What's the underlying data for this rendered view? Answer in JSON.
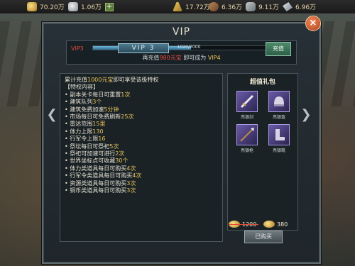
{
  "topbar": {
    "gold": "70.20万",
    "silver": "1.06万",
    "food": "17.72万",
    "wood": "6.36万",
    "stone": "9.11万",
    "iron": "6.96万",
    "plus_label": "+"
  },
  "dialog": {
    "title": "VIP",
    "close_label": "×"
  },
  "vip_progress": {
    "level_label": "VIP3",
    "progress_text": "1020/2000",
    "progress_fraction": 0.51,
    "hint_prefix": "再充值",
    "hint_amount": "980元宝",
    "hint_suffix": "即可成为",
    "hint_target": "VIP4",
    "recharge_label": "充值"
  },
  "banner": {
    "label": "VIP 3"
  },
  "privileges": {
    "intro_prefix": "累计充值",
    "intro_amount": "1000元宝",
    "intro_suffix": "即可享受该级特权",
    "section_header": "【特权内容】",
    "items": [
      {
        "text": "• 副本关卡每日可重置",
        "num": "1次"
      },
      {
        "text": "• 建筑队列",
        "num": "3个"
      },
      {
        "text": "• 建筑免费加速",
        "num": "5分钟"
      },
      {
        "text": "• 市场每日可免费刷新",
        "num": "25次"
      },
      {
        "text": "• 雷达范围",
        "num": "15里"
      },
      {
        "text": "• 体力上限",
        "num": "130"
      },
      {
        "text": "• 行军令上限",
        "num": "16"
      },
      {
        "text": "• 祭坛每日可祭祀",
        "num": "5次"
      },
      {
        "text": "• 祭祀可加速可进行",
        "num": "2次"
      },
      {
        "text": "• 世界坐标点可收藏",
        "num": "30个"
      },
      {
        "text": "• 体力类道具每日可购买",
        "num": "4次"
      },
      {
        "text": "• 行军令类道具每日可购买",
        "num": "4次"
      },
      {
        "text": "• 资源类道具每日可购买",
        "num": "3次"
      },
      {
        "text": "• 铜币类道具每日可购买",
        "num": "3次"
      }
    ]
  },
  "gift": {
    "title": "超值礼包",
    "items": [
      {
        "name": "亮银剑",
        "icon": "sword-icon"
      },
      {
        "name": "亮银盔",
        "icon": "helmet-icon"
      },
      {
        "name": "亮银枪",
        "icon": "spear-icon"
      },
      {
        "name": "亮银靴",
        "icon": "boots-icon"
      }
    ],
    "original_price": "1200",
    "sale_price": "380",
    "buy_label": "已购买"
  },
  "colors": {
    "accent_red": "#e24a3a",
    "accent_gold": "#e9c25a",
    "progress_fill": "#4f96b8"
  }
}
